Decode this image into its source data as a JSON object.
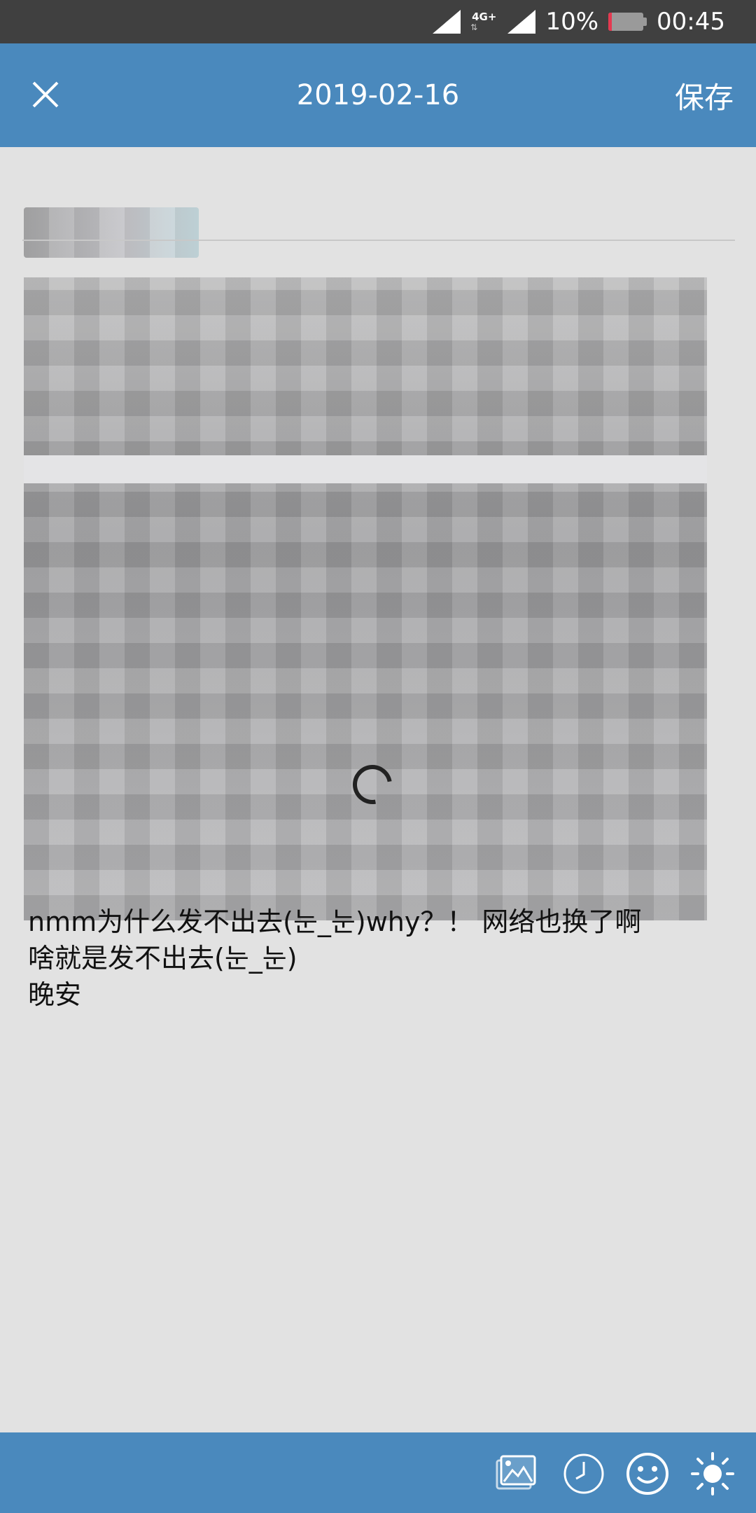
{
  "status_bar": {
    "network_type": "4G+",
    "battery_percent": "10%",
    "battery_level": 0.1,
    "time": "00:45"
  },
  "app_bar": {
    "title": "2019-02-16",
    "save_label": "保存",
    "close_icon": "close-icon"
  },
  "note": {
    "visible_lines": [
      "nmm为什么发不出去(눈_눈)why？！ 网络也换了啊",
      "啥就是发不出去(눈_눈)",
      "晚安"
    ]
  },
  "toolbar": {
    "icons": [
      "image-icon",
      "clock-icon",
      "emoji-icon",
      "brightness-icon"
    ]
  },
  "colors": {
    "status_bar": "#404040",
    "accent": "#4a89bd",
    "background": "#e2e2e2",
    "text": "#111111"
  }
}
